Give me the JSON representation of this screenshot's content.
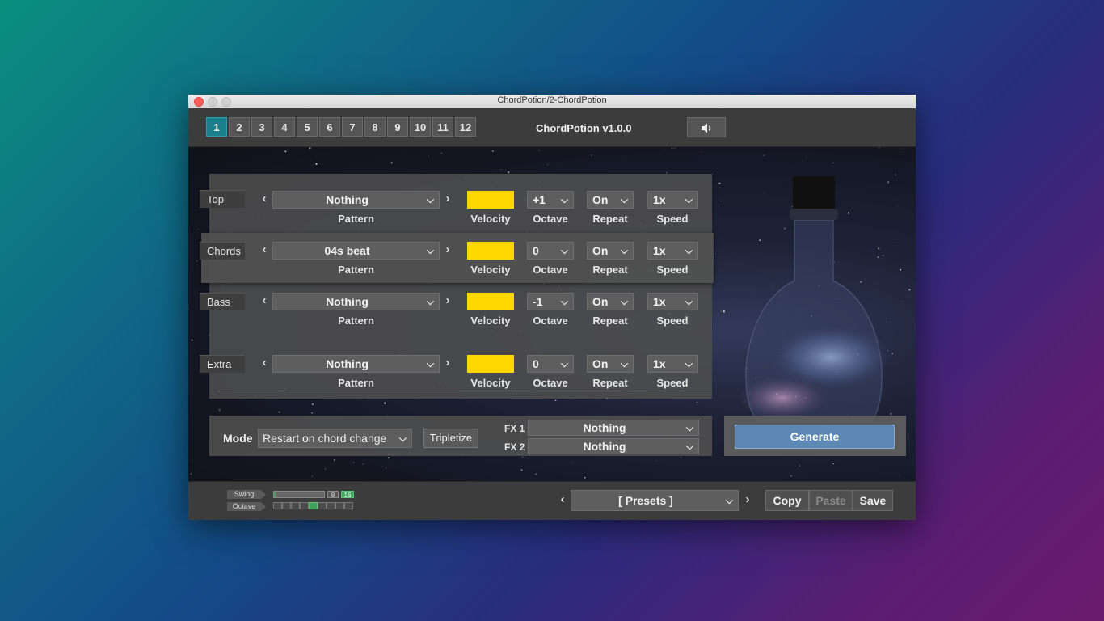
{
  "window": {
    "title": "ChordPotion/2-ChordPotion"
  },
  "header": {
    "tabs": [
      "1",
      "2",
      "3",
      "4",
      "5",
      "6",
      "7",
      "8",
      "9",
      "10",
      "11",
      "12"
    ],
    "active_tab": "1",
    "app_version": "ChordPotion v1.0.0",
    "speaker_icon": "speaker-icon"
  },
  "captions": {
    "pattern": "Pattern",
    "velocity": "Velocity",
    "octave": "Octave",
    "repeat": "Repeat",
    "speed": "Speed"
  },
  "rows": [
    {
      "label": "Top",
      "pattern": "Nothing",
      "octave": "+1",
      "repeat": "On",
      "speed": "1x",
      "velocity_color": "#FFD700"
    },
    {
      "label": "Chords",
      "pattern": "04s beat",
      "octave": "0",
      "repeat": "On",
      "speed": "1x",
      "velocity_color": "#FFD700"
    },
    {
      "label": "Bass",
      "pattern": "Nothing",
      "octave": "-1",
      "repeat": "On",
      "speed": "1x",
      "velocity_color": "#FFD700"
    },
    {
      "label": "Extra",
      "pattern": "Nothing",
      "octave": "0",
      "repeat": "On",
      "speed": "1x",
      "velocity_color": "#FFD700"
    }
  ],
  "mode": {
    "label": "Mode",
    "value": "Restart on chord change",
    "tripletize": "Tripletize",
    "fx1_label": "FX 1",
    "fx1_value": "Nothing",
    "fx2_label": "FX 2",
    "fx2_value": "Nothing"
  },
  "generate": {
    "label": "Generate"
  },
  "footer": {
    "swing_label": "Swing",
    "octave_label": "Octave",
    "swing_box_8": "8",
    "swing_box_16": "16",
    "presets": "[ Presets ]",
    "copy": "Copy",
    "paste": "Paste",
    "save": "Save"
  },
  "colors": {
    "accent": "#1B7F8C",
    "velocity": "#FFD700",
    "generate": "#5D88B3",
    "slider_on": "#3FA25A"
  }
}
